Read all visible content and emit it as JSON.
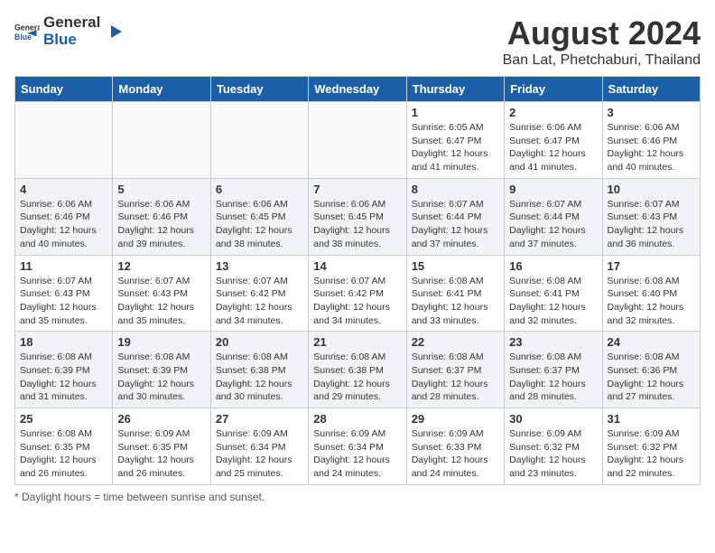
{
  "header": {
    "logo_general": "General",
    "logo_blue": "Blue",
    "month_year": "August 2024",
    "location": "Ban Lat, Phetchaburi, Thailand"
  },
  "days_of_week": [
    "Sunday",
    "Monday",
    "Tuesday",
    "Wednesday",
    "Thursday",
    "Friday",
    "Saturday"
  ],
  "footer": {
    "note": "Daylight hours"
  },
  "weeks": [
    [
      {
        "day": "",
        "info": ""
      },
      {
        "day": "",
        "info": ""
      },
      {
        "day": "",
        "info": ""
      },
      {
        "day": "",
        "info": ""
      },
      {
        "day": "1",
        "info": "Sunrise: 6:05 AM\nSunset: 6:47 PM\nDaylight: 12 hours\nand 41 minutes."
      },
      {
        "day": "2",
        "info": "Sunrise: 6:06 AM\nSunset: 6:47 PM\nDaylight: 12 hours\nand 41 minutes."
      },
      {
        "day": "3",
        "info": "Sunrise: 6:06 AM\nSunset: 6:46 PM\nDaylight: 12 hours\nand 40 minutes."
      }
    ],
    [
      {
        "day": "4",
        "info": "Sunrise: 6:06 AM\nSunset: 6:46 PM\nDaylight: 12 hours\nand 40 minutes."
      },
      {
        "day": "5",
        "info": "Sunrise: 6:06 AM\nSunset: 6:46 PM\nDaylight: 12 hours\nand 39 minutes."
      },
      {
        "day": "6",
        "info": "Sunrise: 6:06 AM\nSunset: 6:45 PM\nDaylight: 12 hours\nand 38 minutes."
      },
      {
        "day": "7",
        "info": "Sunrise: 6:06 AM\nSunset: 6:45 PM\nDaylight: 12 hours\nand 38 minutes."
      },
      {
        "day": "8",
        "info": "Sunrise: 6:07 AM\nSunset: 6:44 PM\nDaylight: 12 hours\nand 37 minutes."
      },
      {
        "day": "9",
        "info": "Sunrise: 6:07 AM\nSunset: 6:44 PM\nDaylight: 12 hours\nand 37 minutes."
      },
      {
        "day": "10",
        "info": "Sunrise: 6:07 AM\nSunset: 6:43 PM\nDaylight: 12 hours\nand 36 minutes."
      }
    ],
    [
      {
        "day": "11",
        "info": "Sunrise: 6:07 AM\nSunset: 6:43 PM\nDaylight: 12 hours\nand 35 minutes."
      },
      {
        "day": "12",
        "info": "Sunrise: 6:07 AM\nSunset: 6:43 PM\nDaylight: 12 hours\nand 35 minutes."
      },
      {
        "day": "13",
        "info": "Sunrise: 6:07 AM\nSunset: 6:42 PM\nDaylight: 12 hours\nand 34 minutes."
      },
      {
        "day": "14",
        "info": "Sunrise: 6:07 AM\nSunset: 6:42 PM\nDaylight: 12 hours\nand 34 minutes."
      },
      {
        "day": "15",
        "info": "Sunrise: 6:08 AM\nSunset: 6:41 PM\nDaylight: 12 hours\nand 33 minutes."
      },
      {
        "day": "16",
        "info": "Sunrise: 6:08 AM\nSunset: 6:41 PM\nDaylight: 12 hours\nand 32 minutes."
      },
      {
        "day": "17",
        "info": "Sunrise: 6:08 AM\nSunset: 6:40 PM\nDaylight: 12 hours\nand 32 minutes."
      }
    ],
    [
      {
        "day": "18",
        "info": "Sunrise: 6:08 AM\nSunset: 6:39 PM\nDaylight: 12 hours\nand 31 minutes."
      },
      {
        "day": "19",
        "info": "Sunrise: 6:08 AM\nSunset: 6:39 PM\nDaylight: 12 hours\nand 30 minutes."
      },
      {
        "day": "20",
        "info": "Sunrise: 6:08 AM\nSunset: 6:38 PM\nDaylight: 12 hours\nand 30 minutes."
      },
      {
        "day": "21",
        "info": "Sunrise: 6:08 AM\nSunset: 6:38 PM\nDaylight: 12 hours\nand 29 minutes."
      },
      {
        "day": "22",
        "info": "Sunrise: 6:08 AM\nSunset: 6:37 PM\nDaylight: 12 hours\nand 28 minutes."
      },
      {
        "day": "23",
        "info": "Sunrise: 6:08 AM\nSunset: 6:37 PM\nDaylight: 12 hours\nand 28 minutes."
      },
      {
        "day": "24",
        "info": "Sunrise: 6:08 AM\nSunset: 6:36 PM\nDaylight: 12 hours\nand 27 minutes."
      }
    ],
    [
      {
        "day": "25",
        "info": "Sunrise: 6:08 AM\nSunset: 6:35 PM\nDaylight: 12 hours\nand 26 minutes."
      },
      {
        "day": "26",
        "info": "Sunrise: 6:09 AM\nSunset: 6:35 PM\nDaylight: 12 hours\nand 26 minutes."
      },
      {
        "day": "27",
        "info": "Sunrise: 6:09 AM\nSunset: 6:34 PM\nDaylight: 12 hours\nand 25 minutes."
      },
      {
        "day": "28",
        "info": "Sunrise: 6:09 AM\nSunset: 6:34 PM\nDaylight: 12 hours\nand 24 minutes."
      },
      {
        "day": "29",
        "info": "Sunrise: 6:09 AM\nSunset: 6:33 PM\nDaylight: 12 hours\nand 24 minutes."
      },
      {
        "day": "30",
        "info": "Sunrise: 6:09 AM\nSunset: 6:32 PM\nDaylight: 12 hours\nand 23 minutes."
      },
      {
        "day": "31",
        "info": "Sunrise: 6:09 AM\nSunset: 6:32 PM\nDaylight: 12 hours\nand 22 minutes."
      }
    ]
  ]
}
